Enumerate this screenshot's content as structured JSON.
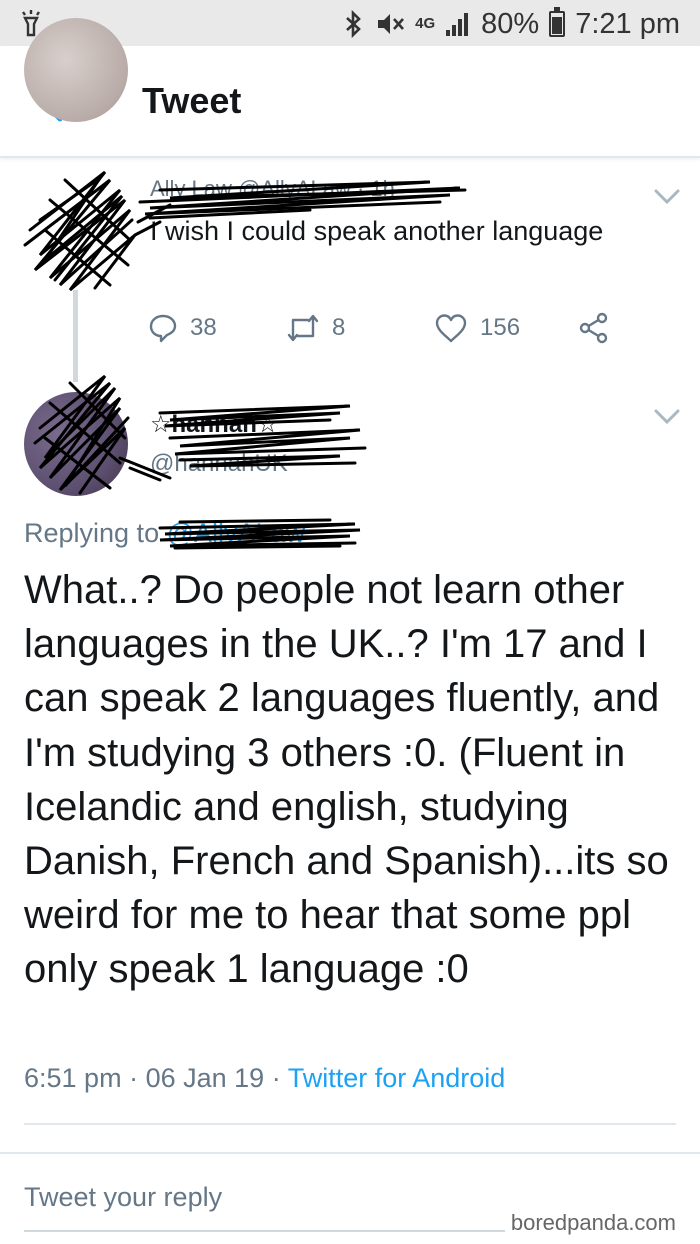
{
  "status_bar": {
    "network": "4G",
    "battery": "80%",
    "time": "7:21 pm"
  },
  "header": {
    "title": "Tweet"
  },
  "original_tweet": {
    "header_text": "Ally Law @AllyALaw · 1h",
    "text": "I wish I could speak another language",
    "replies": "38",
    "retweets": "8",
    "likes": "156"
  },
  "reply_tweet": {
    "name": "☆hannah☆",
    "handle": "@hannahUK",
    "replying_prefix": "Replying to",
    "replying_to": "@AllyALaw",
    "text": "What..? Do people not learn other languages in the UK..? I'm 17 and I can speak 2 languages fluently, and I'm studying 3 others :0. (Fluent in Icelandic and english, studying Danish, French and Spanish)...its so weird for me to hear that some ppl only speak 1 language :0",
    "time": "6:51 pm",
    "date": "06 Jan 19",
    "source": "Twitter for Android"
  },
  "reply_composer": {
    "placeholder": "Tweet your reply"
  },
  "watermark": "boredpanda.com",
  "colors": {
    "accent": "#1da1f2",
    "secondary_text": "#657786",
    "status_bar_bg": "#e9e9ea"
  },
  "icons": {
    "back": "arrow-left-icon",
    "reply": "reply-icon",
    "retweet": "retweet-icon",
    "like": "heart-icon",
    "share": "share-icon",
    "menu": "chevron-down-icon"
  }
}
